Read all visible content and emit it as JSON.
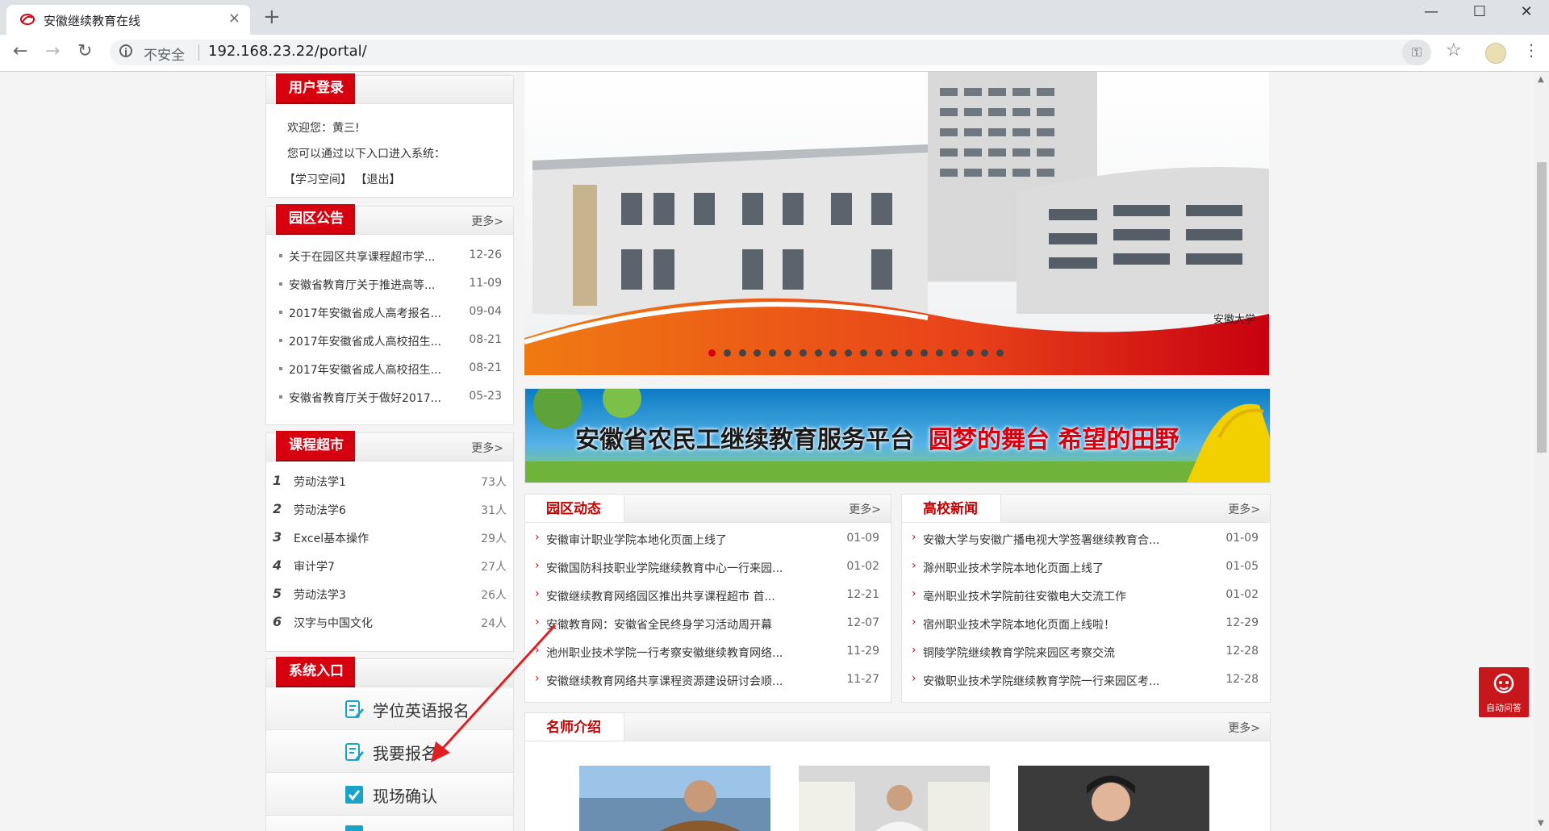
{
  "browser": {
    "tab_title": "安徽继续教育在线",
    "tab_close": "×",
    "new_tab": "+",
    "window_controls": [
      "—",
      "☐",
      "✕"
    ],
    "security_label": "不安全",
    "url": "192.168.23.22/portal/",
    "nav": {
      "back": "←",
      "forward": "→",
      "reload": "↻"
    }
  },
  "login": {
    "title": "用户登录",
    "welcome": "欢迎您：黄三!",
    "hint": "您可以通过以下入口进入系统：",
    "links": "【学习空间】 【退出】"
  },
  "announcements": {
    "title": "园区公告",
    "more": "更多>",
    "items": [
      {
        "text": "关于在园区共享课程超市学...",
        "date": "12-26"
      },
      {
        "text": "安徽省教育厅关于推进高等...",
        "date": "11-09"
      },
      {
        "text": "2017年安徽省成人高考报名...",
        "date": "09-04"
      },
      {
        "text": "2017年安徽省成人高校招生...",
        "date": "08-21"
      },
      {
        "text": "2017年安徽省成人高校招生...",
        "date": "08-21"
      },
      {
        "text": "安徽省教育厅关于做好2017...",
        "date": "05-23"
      }
    ]
  },
  "courses": {
    "title": "课程超市",
    "more": "更多>",
    "items": [
      {
        "icon": "1",
        "name": "劳动法学1",
        "count": "73人"
      },
      {
        "icon": "2",
        "name": "劳动法学6",
        "count": "31人"
      },
      {
        "icon": "3",
        "name": "Excel基本操作",
        "count": "29人"
      },
      {
        "icon": "4",
        "name": "审计学7",
        "count": "27人"
      },
      {
        "icon": "5",
        "name": "劳动法学3",
        "count": "26人"
      },
      {
        "icon": "6",
        "name": "汉字与中国文化",
        "count": "24人"
      }
    ]
  },
  "system_entry": {
    "title": "系统入口",
    "items": [
      {
        "label": "学位英语报名",
        "icon": "edit-form-icon"
      },
      {
        "label": "我要报名",
        "icon": "edit-form-icon"
      },
      {
        "label": "现场确认",
        "icon": "checkbox-icon"
      }
    ]
  },
  "slider": {
    "caption": "安徽大学",
    "dot_count": 20,
    "active_dot": 0
  },
  "banner": {
    "title": "安徽省农民工继续教育服务平台",
    "slogan": "圆梦的舞台 希望的田野"
  },
  "campus_news": {
    "title": "园区动态",
    "more": "更多>",
    "items": [
      {
        "text": "安徽审计职业学院本地化页面上线了",
        "date": "01-09"
      },
      {
        "text": "安徽国防科技职业学院继续教育中心一行来园...",
        "date": "01-02"
      },
      {
        "text": "安徽继续教育网络园区推出共享课程超市 首...",
        "date": "12-21"
      },
      {
        "text": "安徽教育网：安徽省全民终身学习活动周开幕",
        "date": "12-07"
      },
      {
        "text": "池州职业技术学院一行考察安徽继续教育网络...",
        "date": "11-29"
      },
      {
        "text": "安徽继续教育网络共享课程资源建设研讨会顺...",
        "date": "11-27"
      }
    ]
  },
  "college_news": {
    "title": "高校新闻",
    "more": "更多>",
    "items": [
      {
        "text": "安徽大学与安徽广播电视大学签署继续教育合...",
        "date": "01-09"
      },
      {
        "text": "滁州职业技术学院本地化页面上线了",
        "date": "01-05"
      },
      {
        "text": "亳州职业技术学院前往安徽电大交流工作",
        "date": "01-02"
      },
      {
        "text": "宿州职业技术学院本地化页面上线啦！",
        "date": "12-29"
      },
      {
        "text": "铜陵学院继续教育学院来园区考察交流",
        "date": "12-28"
      },
      {
        "text": "安徽职业技术学院继续教育学院一行来园区考...",
        "date": "12-28"
      }
    ]
  },
  "teachers": {
    "title": "名师介绍",
    "more": "更多>"
  },
  "float_service": {
    "label": "自动问答",
    "color": "#c8161d"
  },
  "colors": {
    "accent_red": "#d7000f",
    "link_red": "#c40000"
  }
}
